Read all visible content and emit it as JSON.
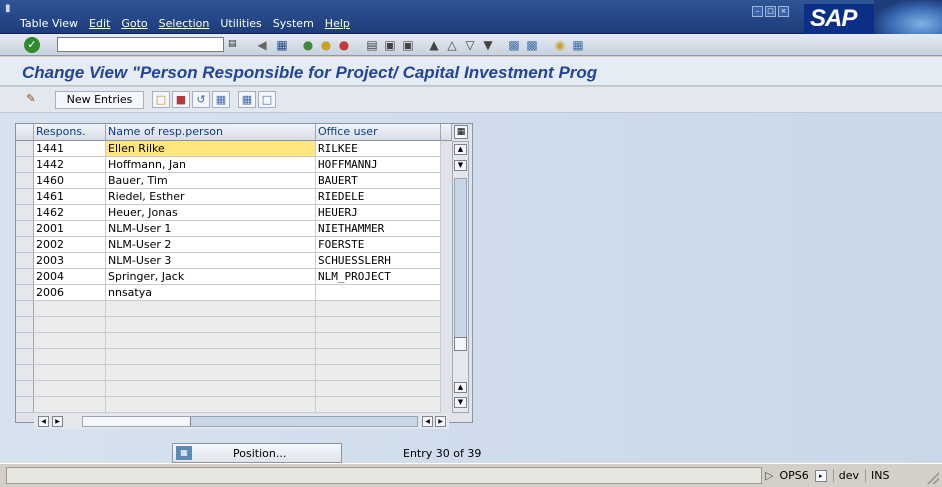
{
  "menubar": {
    "items": [
      {
        "label": "Table View"
      },
      {
        "label": "Edit"
      },
      {
        "label": "Goto"
      },
      {
        "label": "Selection"
      },
      {
        "label": "Utilities"
      },
      {
        "label": "System"
      },
      {
        "label": "Help"
      }
    ],
    "logo": "SAP"
  },
  "title": "Change View \"Person Responsible for Project/ Capital Investment Prog",
  "app_toolbar": {
    "new_entries_label": "New Entries"
  },
  "table": {
    "columns": [
      "Respons.",
      "Name of resp.person",
      "Office user"
    ],
    "rows": [
      {
        "id": "1441",
        "name": "Ellen Rilke",
        "user": "RILKEE"
      },
      {
        "id": "1442",
        "name": "Hoffmann, Jan",
        "user": "HOFFMANNJ"
      },
      {
        "id": "1460",
        "name": "Bauer, Tim",
        "user": "BAUERT"
      },
      {
        "id": "1461",
        "name": "Riedel, Esther",
        "user": "RIEDELE"
      },
      {
        "id": "1462",
        "name": "Heuer, Jonas",
        "user": "HEUERJ"
      },
      {
        "id": "2001",
        "name": "NLM-User 1",
        "user": "NIETHAMMER"
      },
      {
        "id": "2002",
        "name": "NLM-User 2",
        "user": "FOERSTE"
      },
      {
        "id": "2003",
        "name": "NLM-User 3",
        "user": "SCHUESSLERH"
      },
      {
        "id": "2004",
        "name": "Springer, Jack",
        "user": "NLM_PROJECT"
      },
      {
        "id": "2006",
        "name": "nnsatya",
        "user": ""
      }
    ],
    "empty_row_count": 6
  },
  "footer": {
    "position_label": "Position...",
    "entry_text": "Entry 30 of 39"
  },
  "statusbar": {
    "system": "OPS6",
    "client": "dev",
    "mode": "INS"
  },
  "colors": {
    "title": "#22449a",
    "menubar": "#2f5597",
    "highlight": "#ffe680"
  }
}
